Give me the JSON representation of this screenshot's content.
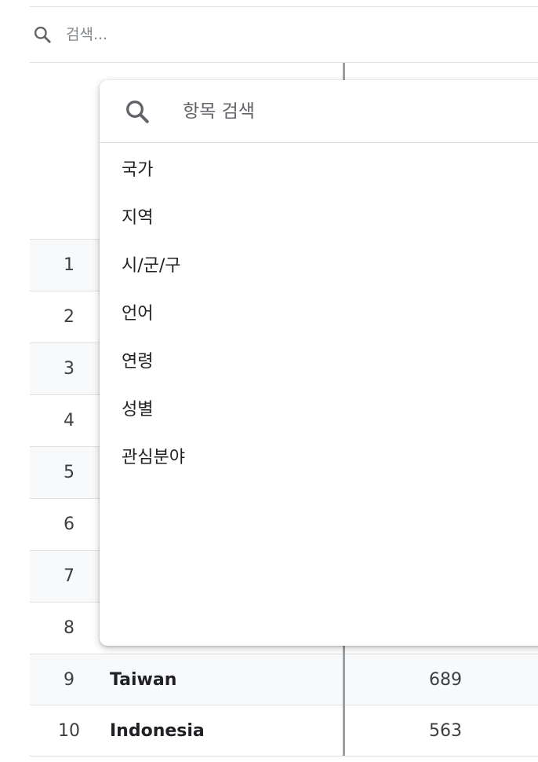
{
  "top_search": {
    "placeholder": "검색..."
  },
  "dropdown": {
    "search_placeholder": "항목 검색",
    "items": [
      {
        "label": "국가"
      },
      {
        "label": "지역"
      },
      {
        "label": "시/군/구"
      },
      {
        "label": "언어"
      },
      {
        "label": "연령"
      },
      {
        "label": "성별"
      },
      {
        "label": "관심분야"
      }
    ]
  },
  "table": {
    "rows": [
      {
        "num": "1",
        "name": "",
        "value": ""
      },
      {
        "num": "2",
        "name": "",
        "value": ""
      },
      {
        "num": "3",
        "name": "",
        "value": ""
      },
      {
        "num": "4",
        "name": "",
        "value": ""
      },
      {
        "num": "5",
        "name": "",
        "value": ""
      },
      {
        "num": "6",
        "name": "",
        "value": ""
      },
      {
        "num": "7",
        "name": "",
        "value": ""
      },
      {
        "num": "8",
        "name": "",
        "value": ""
      },
      {
        "num": "9",
        "name": "Taiwan",
        "value": "689"
      },
      {
        "num": "10",
        "name": "Indonesia",
        "value": "563"
      }
    ]
  },
  "icons": {
    "top_search": "search-icon",
    "dropdown_search": "search-icon"
  }
}
